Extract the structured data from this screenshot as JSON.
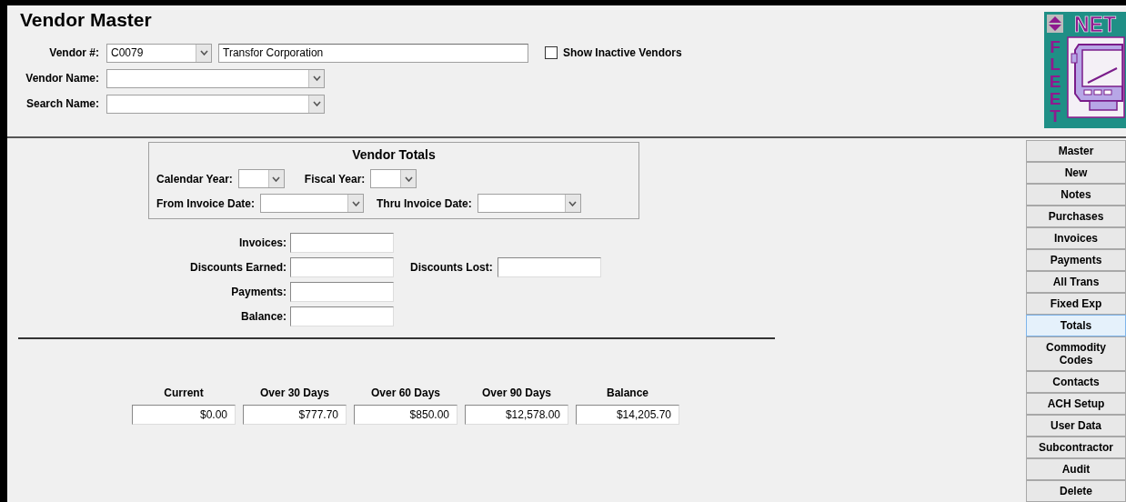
{
  "window": {
    "title": "Vendor Master"
  },
  "logo": {
    "top_text": "NET",
    "side_text": "FLEET"
  },
  "header": {
    "vendor_number": {
      "label": "Vendor #:",
      "value": "C0079"
    },
    "vendor_description": {
      "value": "Transfor Corporation"
    },
    "show_inactive": {
      "label": "Show Inactive Vendors",
      "checked": false
    },
    "vendor_name": {
      "label": "Vendor Name:"
    },
    "search_name": {
      "label": "Search Name:"
    }
  },
  "totals_box": {
    "title": "Vendor Totals",
    "calendar_year_label": "Calendar Year:",
    "fiscal_year_label": "Fiscal Year:",
    "from_date_label": "From Invoice Date:",
    "thru_date_label": "Thru Invoice Date:"
  },
  "summary_fields": {
    "invoices": {
      "label": "Invoices:"
    },
    "discounts_earned": {
      "label": "Discounts Earned:"
    },
    "discounts_lost": {
      "label": "Discounts Lost:"
    },
    "payments": {
      "label": "Payments:"
    },
    "balance": {
      "label": "Balance:"
    }
  },
  "aging": [
    {
      "heading": "Current",
      "value": "$0.00"
    },
    {
      "heading": "Over 30 Days",
      "value": "$777.70"
    },
    {
      "heading": "Over 60 Days",
      "value": "$850.00"
    },
    {
      "heading": "Over 90 Days",
      "value": "$12,578.00"
    },
    {
      "heading": "Balance",
      "value": "$14,205.70"
    }
  ],
  "nav_buttons": [
    {
      "label": "Master",
      "selected": false
    },
    {
      "label": "New",
      "selected": false
    },
    {
      "label": "Notes",
      "selected": false
    },
    {
      "label": "Purchases",
      "selected": false
    },
    {
      "label": "Invoices",
      "selected": false
    },
    {
      "label": "Payments",
      "selected": false
    },
    {
      "label": "All Trans",
      "selected": false
    },
    {
      "label": "Fixed Exp",
      "selected": false
    },
    {
      "label": "Totals",
      "selected": true
    },
    {
      "label": "Commodity Codes",
      "selected": false
    },
    {
      "label": "Contacts",
      "selected": false
    },
    {
      "label": "ACH Setup",
      "selected": false
    },
    {
      "label": "User Data",
      "selected": false
    },
    {
      "label": "Subcontractor",
      "selected": false
    },
    {
      "label": "Audit",
      "selected": false
    },
    {
      "label": "Delete",
      "selected": false
    }
  ]
}
